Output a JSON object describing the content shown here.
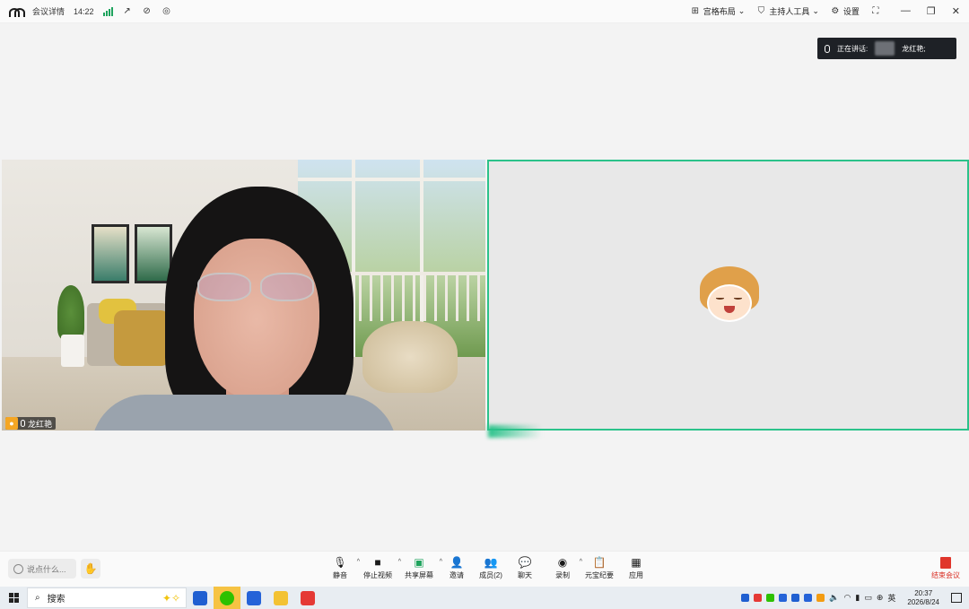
{
  "titlebar": {
    "meeting_details": "会议详情",
    "time": "14:22",
    "layout_button": "宫格布局",
    "host_tools_button": "主持人工具",
    "settings_button": "设置"
  },
  "speaking": {
    "label": "正在讲话:",
    "name": "龙红艳;"
  },
  "participants": [
    {
      "name": "龙红艳"
    }
  ],
  "toolbar": {
    "say_placeholder": "说点什么...",
    "items": [
      {
        "label": "静音",
        "icon": "mic-icon"
      },
      {
        "label": "停止视频",
        "icon": "camera-icon"
      },
      {
        "label": "共享屏幕",
        "icon": "share-screen-icon"
      },
      {
        "label": "邀请",
        "icon": "invite-icon"
      },
      {
        "label": "成员(2)",
        "icon": "members-icon"
      },
      {
        "label": "聊天",
        "icon": "chat-icon"
      },
      {
        "label": "录制",
        "icon": "record-icon"
      },
      {
        "label": "元宝纪要",
        "icon": "minutes-icon"
      },
      {
        "label": "应用",
        "icon": "apps-icon"
      }
    ],
    "end_meeting": "结束会议"
  },
  "taskbar": {
    "search_label": "搜索",
    "ime": "英",
    "time": "20:37",
    "date": "2026/8/24"
  },
  "colors": {
    "active_speaker_border": "#2bc28a",
    "end_meeting": "#d93025",
    "signal": "#1ea35d"
  }
}
